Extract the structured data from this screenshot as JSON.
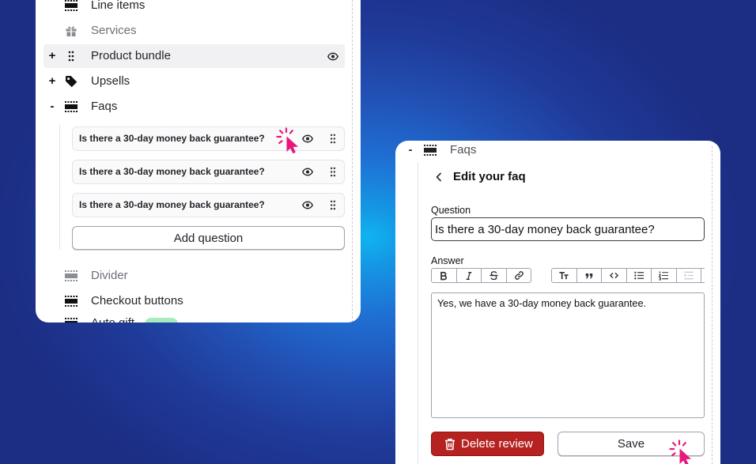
{
  "left_panel": {
    "items": {
      "line_items": {
        "label": "Line items",
        "icon": "block-icon"
      },
      "services": {
        "label": "Services",
        "icon": "gift-icon"
      },
      "product_bundle": {
        "toggle": "+",
        "label": "Product bundle",
        "icon": "drag-handle-icon",
        "highlighted": true
      },
      "upsells": {
        "toggle": "+",
        "label": "Upsells",
        "icon": "tag-icon"
      },
      "faqs": {
        "toggle": "-",
        "label": "Faqs",
        "icon": "block-icon"
      },
      "divider": {
        "label": "Divider",
        "icon": "block-icon"
      },
      "checkout_buttons": {
        "label": "Checkout buttons",
        "icon": "block-icon"
      },
      "auto_gift": {
        "label": "Auto gift",
        "icon": "block-icon"
      }
    },
    "faq_questions": [
      "Is there a 30-day money back guarantee?",
      "Is there a 30-day money back guarantee?",
      "Is there a 30-day money back guarantee?"
    ],
    "add_question_label": "Add question"
  },
  "right_panel": {
    "faqs": {
      "toggle": "-",
      "label": "Faqs",
      "icon": "block-icon"
    },
    "title": "Edit your faq",
    "question": {
      "label": "Question",
      "value": "Is there a 30-day money back guarantee?"
    },
    "answer": {
      "label": "Answer",
      "value": "Yes, we have a 30-day money back guarantee."
    },
    "toolbar": {
      "format_group": [
        "bold-icon",
        "italic-icon",
        "strikethrough-icon",
        "link-icon"
      ],
      "block_group": [
        "heading-icon",
        "blockquote-icon",
        "code-icon",
        "bullet-list-icon",
        "numbered-list-icon",
        "indent-icon"
      ]
    },
    "delete_label": "Delete review",
    "delete_icon": "trash-icon",
    "save_label": "Save"
  },
  "colors": {
    "cursor_accent": "#e8177d",
    "danger": "#b52220",
    "muted_text": "#6b6f76",
    "highlight_row": "#f1f1f3",
    "badge_green": "#a7edbb",
    "background_glow": "#10b4f0",
    "background_dark": "#1c2d84"
  }
}
